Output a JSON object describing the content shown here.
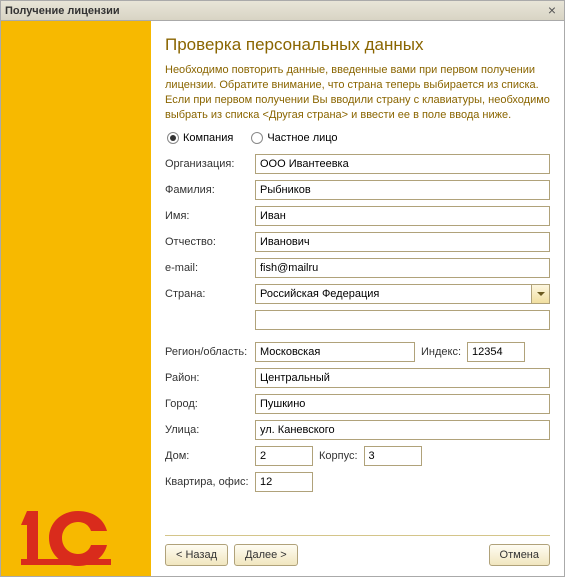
{
  "window": {
    "title": "Получение лицензии"
  },
  "heading": "Проверка персональных данных",
  "instructions": "Необходимо повторить данные, введенные вами при первом получении лицензии. Обратите внимание, что страна теперь выбирается из списка. Если при первом получении Вы вводили страну с клавиатуры, необходимо выбрать из списка <Другая страна> и ввести ее в поле ввода ниже.",
  "entity_type": {
    "company": "Компания",
    "person": "Частное лицо",
    "selected": "company"
  },
  "labels": {
    "organization": "Организация:",
    "surname": "Фамилия:",
    "name": "Имя:",
    "patronymic": "Отчество:",
    "email": "e-mail:",
    "country": "Страна:",
    "region": "Регион/область:",
    "index": "Индекс:",
    "district": "Район:",
    "city": "Город:",
    "street": "Улица:",
    "house": "Дом:",
    "building": "Корпус:",
    "apartment": "Квартира, офис:"
  },
  "values": {
    "organization": "ООО Ивантеевка",
    "surname": "Рыбников",
    "name": "Иван",
    "patronymic": "Иванович",
    "email": "fish@mailru",
    "country": "Российская Федерация",
    "country_other": "",
    "region": "Московская",
    "index": "12354",
    "district": "Центральный",
    "city": "Пушкино",
    "street": "ул. Каневского",
    "house": "2",
    "building": "3",
    "apartment": "12"
  },
  "buttons": {
    "back": "< Назад",
    "next": "Далее >",
    "cancel": "Отмена"
  }
}
